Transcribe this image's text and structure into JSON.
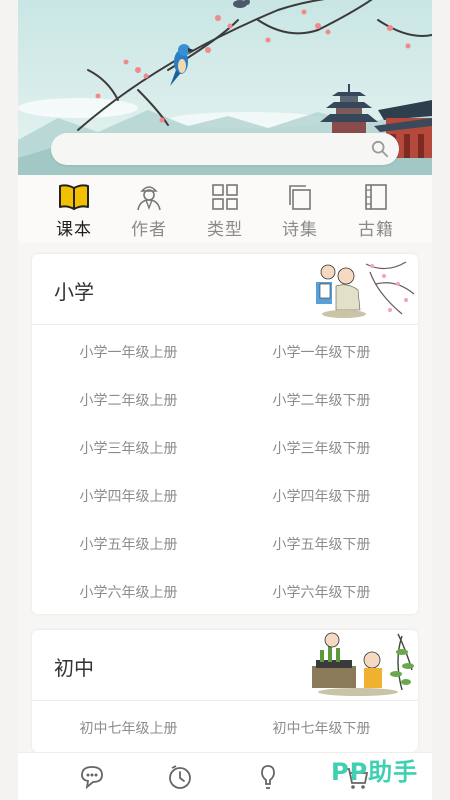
{
  "search": {
    "placeholder": ""
  },
  "tabs": [
    {
      "label": "课本",
      "icon": "book-icon",
      "active": true
    },
    {
      "label": "作者",
      "icon": "author-icon",
      "active": false
    },
    {
      "label": "类型",
      "icon": "grid-icon",
      "active": false
    },
    {
      "label": "诗集",
      "icon": "collection-icon",
      "active": false
    },
    {
      "label": "古籍",
      "icon": "ancient-book-icon",
      "active": false
    }
  ],
  "sections": [
    {
      "title": "小学",
      "grades": [
        [
          "小学一年级上册",
          "小学一年级下册"
        ],
        [
          "小学二年级上册",
          "小学二年级下册"
        ],
        [
          "小学三年级上册",
          "小学三年级下册"
        ],
        [
          "小学四年级上册",
          "小学四年级下册"
        ],
        [
          "小学五年级上册",
          "小学五年级下册"
        ],
        [
          "小学六年级上册",
          "小学六年级下册"
        ]
      ]
    },
    {
      "title": "初中",
      "grades": [
        [
          "初中七年级上册",
          "初中七年级下册"
        ]
      ]
    }
  ],
  "bottom_nav": [
    "chat-icon",
    "history-icon",
    "hint-icon",
    "cart-icon"
  ],
  "watermark": "PP助手",
  "colors": {
    "accent": "#f2c000",
    "watermark": "#3fd0b3",
    "sky": "#bfe0df"
  }
}
